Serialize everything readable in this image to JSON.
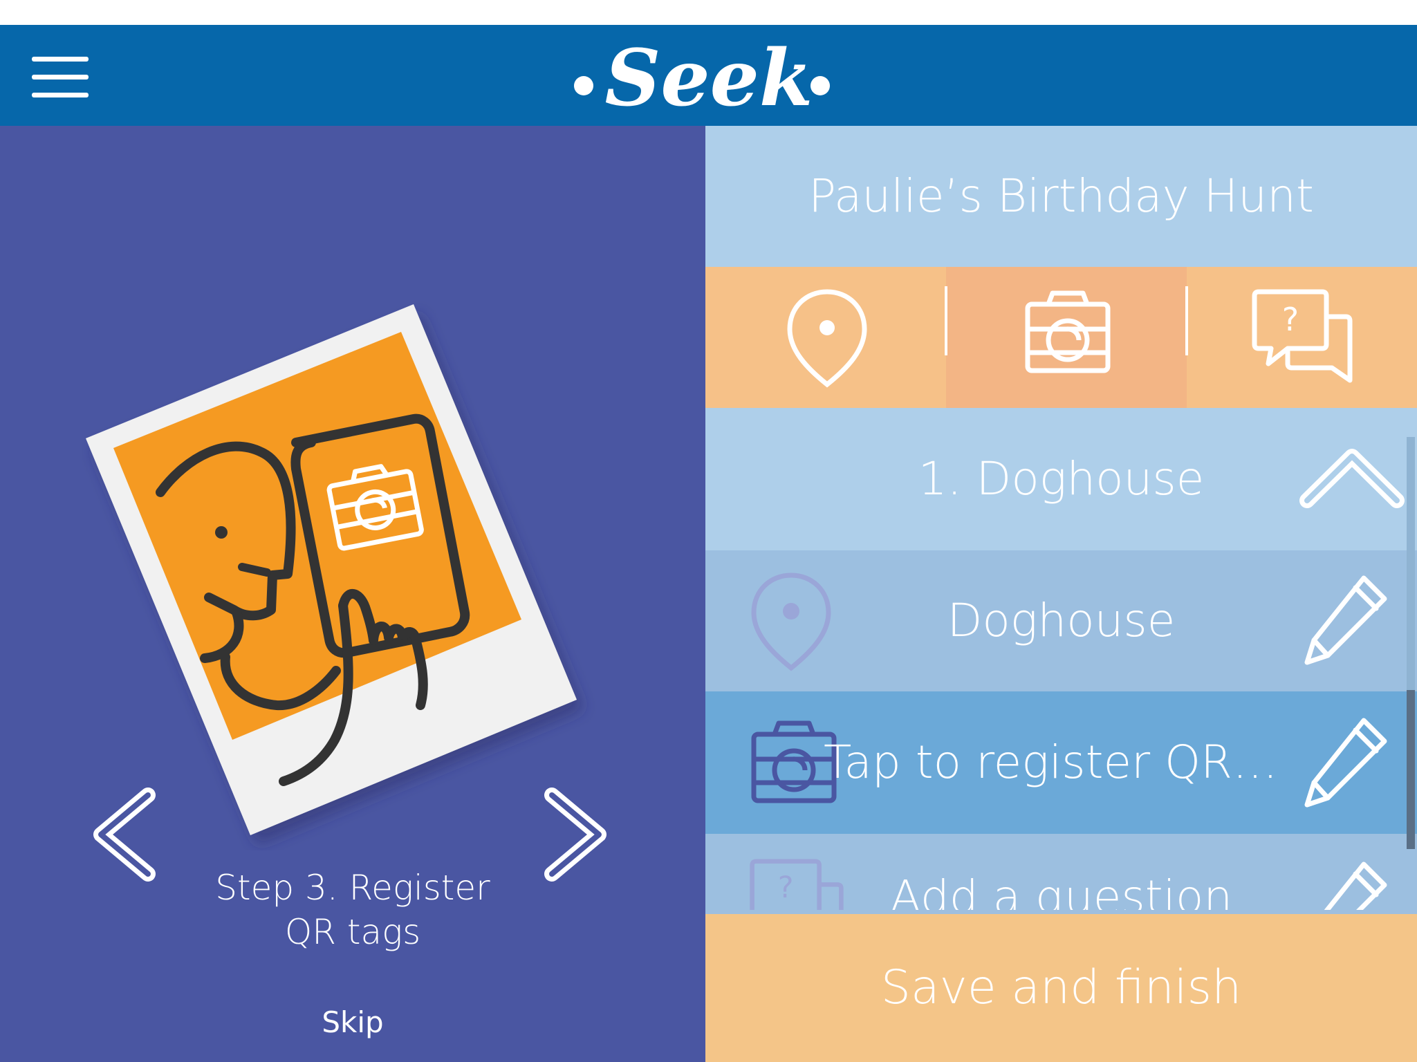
{
  "header": {
    "app_name": "Seek",
    "menu_icon": "hamburger-menu-icon",
    "brand_color": "#0667aa"
  },
  "tutorial": {
    "step_caption_line1": "Step 3. Register",
    "step_caption_line2": "QR tags",
    "skip_label": "Skip",
    "prev_icon": "chevron-left-icon",
    "next_icon": "chevron-right-icon",
    "illustration": "person-holding-phone-camera-illustration",
    "panel_color": "#4a56a2",
    "accent_color": "#f59a22"
  },
  "editor": {
    "hunt_title": "Paulie’s Birthday Hunt",
    "clue_types": [
      {
        "icon": "map-pin-icon",
        "selected": false
      },
      {
        "icon": "camera-icon",
        "selected": true
      },
      {
        "icon": "question-chat-icon",
        "selected": false
      }
    ],
    "clue_header": "1. Doghouse",
    "collapse_icon": "chevron-up-icon",
    "rows": [
      {
        "icon": "map-pin-icon",
        "label": "Doghouse",
        "edit_icon": "pencil-icon"
      },
      {
        "icon": "camera-icon",
        "label": "Tap to register QR…",
        "edit_icon": "pencil-icon"
      },
      {
        "icon": "question-chat-icon",
        "label": "Add a question",
        "edit_icon": "pencil-icon"
      }
    ],
    "save_label": "Save and finish",
    "colors": {
      "title_bar": "#aecfea",
      "type_bar": "#f6c188",
      "active_row": "#6ba9d8",
      "save_button": "#f4c588"
    }
  }
}
